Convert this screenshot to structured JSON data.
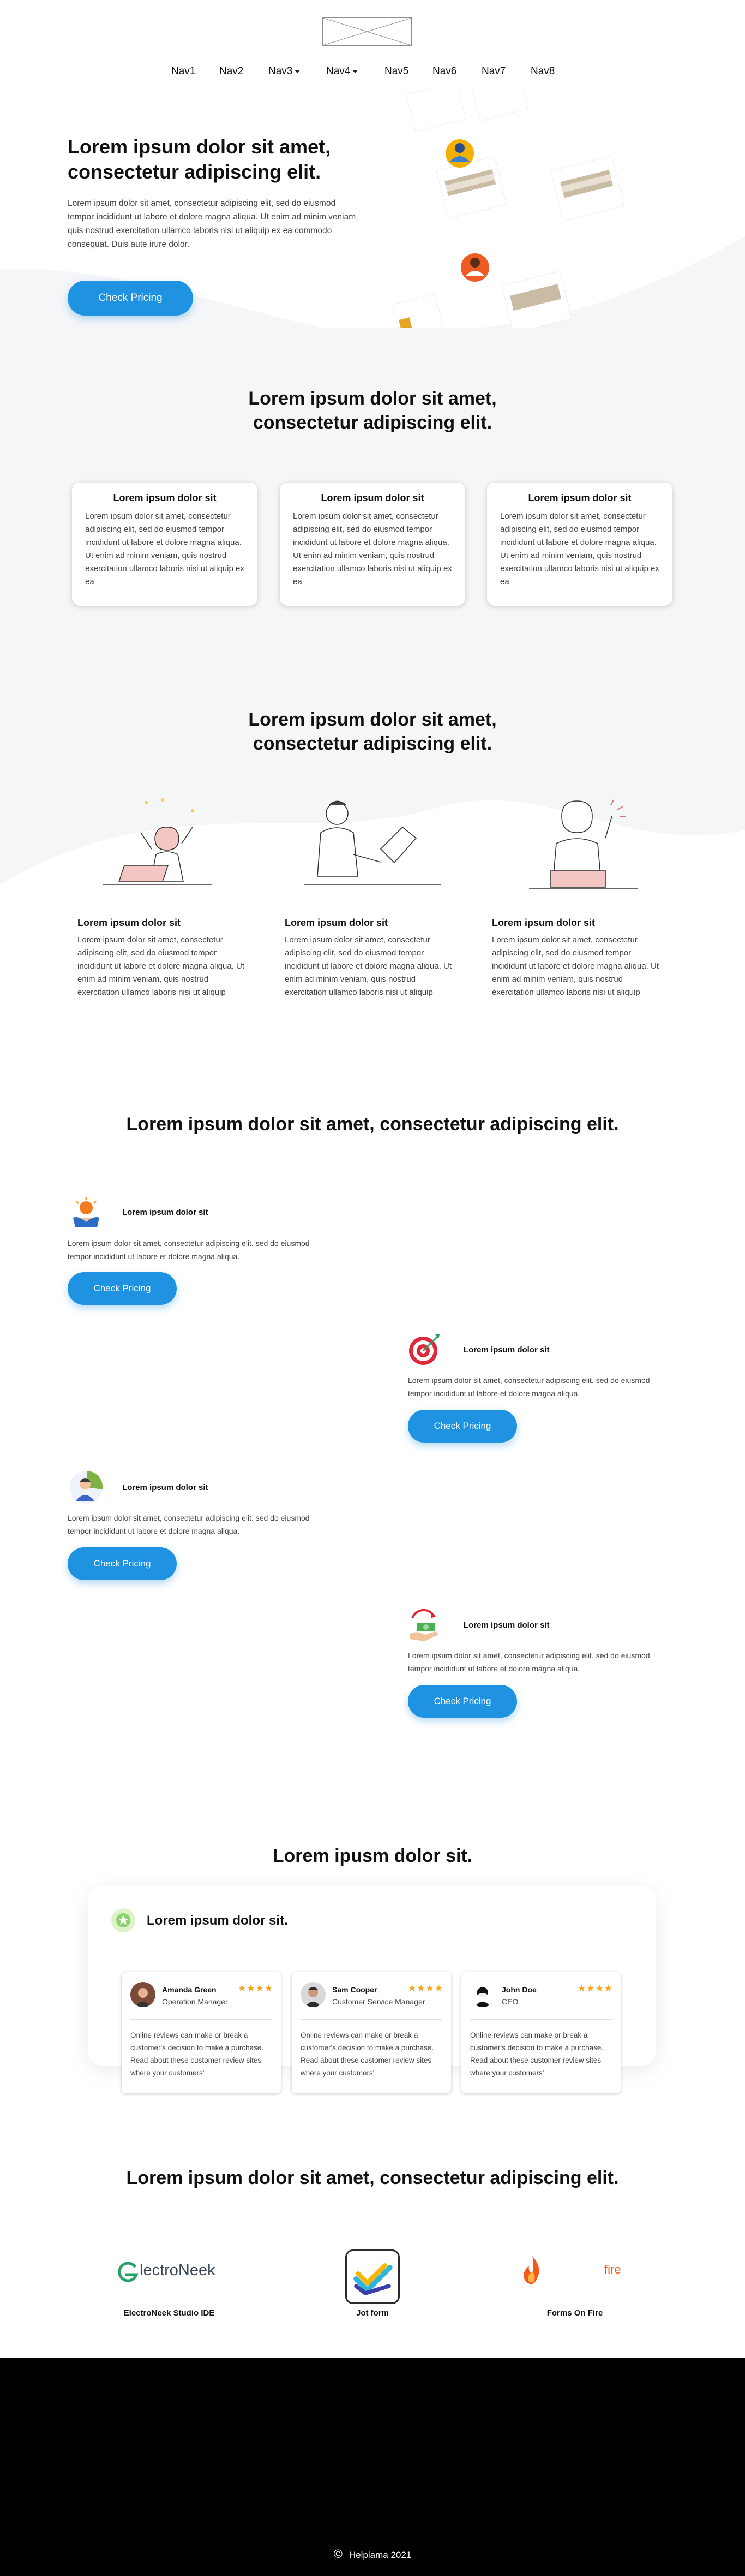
{
  "nav": {
    "items": [
      "Nav1",
      "Nav2",
      "Nav3",
      "Nav4",
      "Nav5",
      "Nav6",
      "Nav7",
      "Nav8"
    ]
  },
  "hero": {
    "title": "Lorem ipsum dolor sit amet, consectetur adipiscing elit.",
    "text": "Lorem ipsum dolor sit amet, consectetur adipiscing elit, sed do eiusmod tempor incididunt ut labore et dolore magna aliqua. Ut enim ad minim veniam, quis nostrud exercitation ullamco laboris nisi ut aliquip ex ea commodo consequat. Duis aute irure dolor.",
    "button": "Check Pricing"
  },
  "cards_section": {
    "title": "Lorem ipsum dolor sit amet, consectetur adipiscing elit.",
    "cards": [
      {
        "title": "Lorem ipsum dolor sit",
        "text": "Lorem ipsum dolor sit amet, consectetur adipiscing elit, sed do eiusmod tempor incididunt ut labore et dolore magna aliqua. Ut enim ad minim veniam, quis nostrud exercitation ullamco laboris nisi ut aliquip ex ea"
      },
      {
        "title": "Lorem ipsum dolor sit",
        "text": "Lorem ipsum dolor sit amet, consectetur adipiscing elit, sed do eiusmod tempor incididunt ut labore et dolore magna aliqua. Ut enim ad minim veniam, quis nostrud exercitation ullamco laboris nisi ut aliquip ex ea"
      },
      {
        "title": "Lorem ipsum dolor sit",
        "text": "Lorem ipsum dolor sit amet, consectetur adipiscing elit, sed do eiusmod tempor incididunt ut labore et dolore magna aliqua. Ut enim ad minim veniam, quis nostrud exercitation ullamco laboris nisi ut aliquip ex ea"
      }
    ]
  },
  "illus_section": {
    "title": "Lorem ipsum dolor sit amet, consectetur adipiscing elit.",
    "items": [
      {
        "title": "Lorem ipsum dolor sit",
        "text": "Lorem ipsum dolor sit amet, consectetur adipiscing elit, sed do eiusmod tempor incididunt ut labore et dolore magna aliqua. Ut enim ad minim veniam, quis nostrud exercitation ullamco laboris nisi ut aliquip"
      },
      {
        "title": "Lorem ipsum dolor sit",
        "text": "Lorem ipsum dolor sit amet, consectetur adipiscing elit, sed do eiusmod tempor incididunt ut labore et dolore magna aliqua. Ut enim ad minim veniam, quis nostrud exercitation ullamco laboris nisi ut aliquip"
      },
      {
        "title": "Lorem ipsum dolor sit",
        "text": "Lorem ipsum dolor sit amet, consectetur adipiscing elit, sed do eiusmod tempor incididunt ut labore et dolore magna aliqua. Ut enim ad minim veniam, quis nostrud exercitation ullamco laboris nisi ut aliquip"
      }
    ]
  },
  "features_section": {
    "title": "Lorem ipsum dolor sit amet, consectetur adipiscing elit.",
    "items": [
      {
        "title": "Lorem ipsum dolor sit",
        "text": "Lorem ipsum dolor sit amet, consectetur adipiscing elit. sed do eiusmod tempor incididunt ut labore et dolore magna aliqua.",
        "button": "Check Pricing",
        "icon": "hand-sun-icon"
      },
      {
        "title": "Lorem ipsum dolor sit",
        "text": "Lorem ipsum dolor sit amet, consectetur adipiscing elit. sed do eiusmod tempor incididunt ut labore et dolore magna aliqua.",
        "button": "Check Pricing",
        "icon": "target-icon"
      },
      {
        "title": "Lorem ipsum dolor sit",
        "text": "Lorem ipsum dolor sit amet, consectetur adipiscing elit. sed do eiusmod tempor incididunt ut labore et dolore magna aliqua.",
        "button": "Check Pricing",
        "icon": "support-agent-icon"
      },
      {
        "title": "Lorem ipsum dolor sit",
        "text": "Lorem ipsum dolor sit amet, consectetur adipiscing elit. sed do eiusmod tempor incididunt ut labore et dolore magna aliqua.",
        "button": "Check Pricing",
        "icon": "hand-money-icon"
      }
    ]
  },
  "reviews_section": {
    "title": "Lorem ipusm dolor sit.",
    "panel_title": "Lorem ipsum dolor sit.",
    "reviews": [
      {
        "name": "Amanda Green",
        "role": "Operation Manager",
        "stars": "★★★★",
        "text": "Online reviews can make or break a customer's decision to make a purchase. Read about these customer review sites where your customers'"
      },
      {
        "name": "Sam Cooper",
        "role": "Customer Service Manager",
        "stars": "★★★★",
        "text": "Online reviews can make or break a customer's decision to make a purchase. Read about these customer review sites where your customers'"
      },
      {
        "name": "John Doe",
        "role": "CEO",
        "stars": "★★★★",
        "text": "Online reviews can make or break a customer's decision to make a purchase. Read about these customer review sites where your customers'"
      }
    ]
  },
  "partners_section": {
    "title": "Lorem ipsum dolor sit amet, consectetur adipiscing elit.",
    "partners": [
      {
        "logo_text": "lectroNeek",
        "label": "ElectroNeek Studio IDE"
      },
      {
        "logo_text": "",
        "label": "Jot form"
      },
      {
        "logo_text": "fire",
        "label": "Forms On Fire"
      }
    ]
  },
  "footer": {
    "symbol": "©",
    "text": "Helplama 2021"
  },
  "colors": {
    "accent": "#1f93e1",
    "section_bg": "#f5f6f8",
    "footer_bg": "#000000",
    "star": "#f7a51c"
  }
}
